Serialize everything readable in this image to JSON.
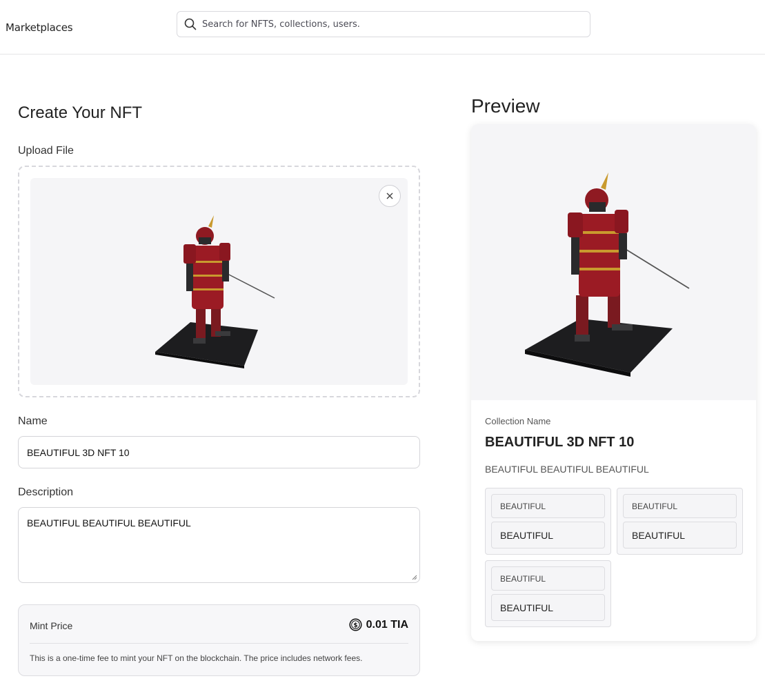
{
  "header": {
    "brand": "Marketplaces",
    "search_placeholder": "Search for NFTS, collections, users."
  },
  "form": {
    "title": "Create Your NFT",
    "upload_label": "Upload File",
    "name_label": "Name",
    "name_value": "BEAUTIFUL 3D NFT 10",
    "description_label": "Description",
    "description_value": "BEAUTIFUL BEAUTIFUL BEAUTIFUL",
    "mint": {
      "label": "Mint Price",
      "price": "0.01 TIA",
      "note": "This is a one-time fee to mint your NFT on the blockchain. The price includes network fees."
    }
  },
  "preview": {
    "title": "Preview",
    "collection_label": "Collection Name",
    "nft_name": "BEAUTIFUL 3D NFT 10",
    "nft_description": "BEAUTIFUL BEAUTIFUL BEAUTIFUL",
    "attributes": [
      {
        "trait": "BEAUTIFUL",
        "value": "BEAUTIFUL"
      },
      {
        "trait": "BEAUTIFUL",
        "value": "BEAUTIFUL"
      },
      {
        "trait": "BEAUTIFUL",
        "value": "BEAUTIFUL"
      }
    ]
  },
  "colors": {
    "armor_red": "#9b1b24",
    "base_black": "#1d1d1f",
    "gold_trim": "#c99a2e"
  },
  "icons": {
    "search": "search-icon",
    "close": "close-icon",
    "coin": "coin-icon"
  }
}
